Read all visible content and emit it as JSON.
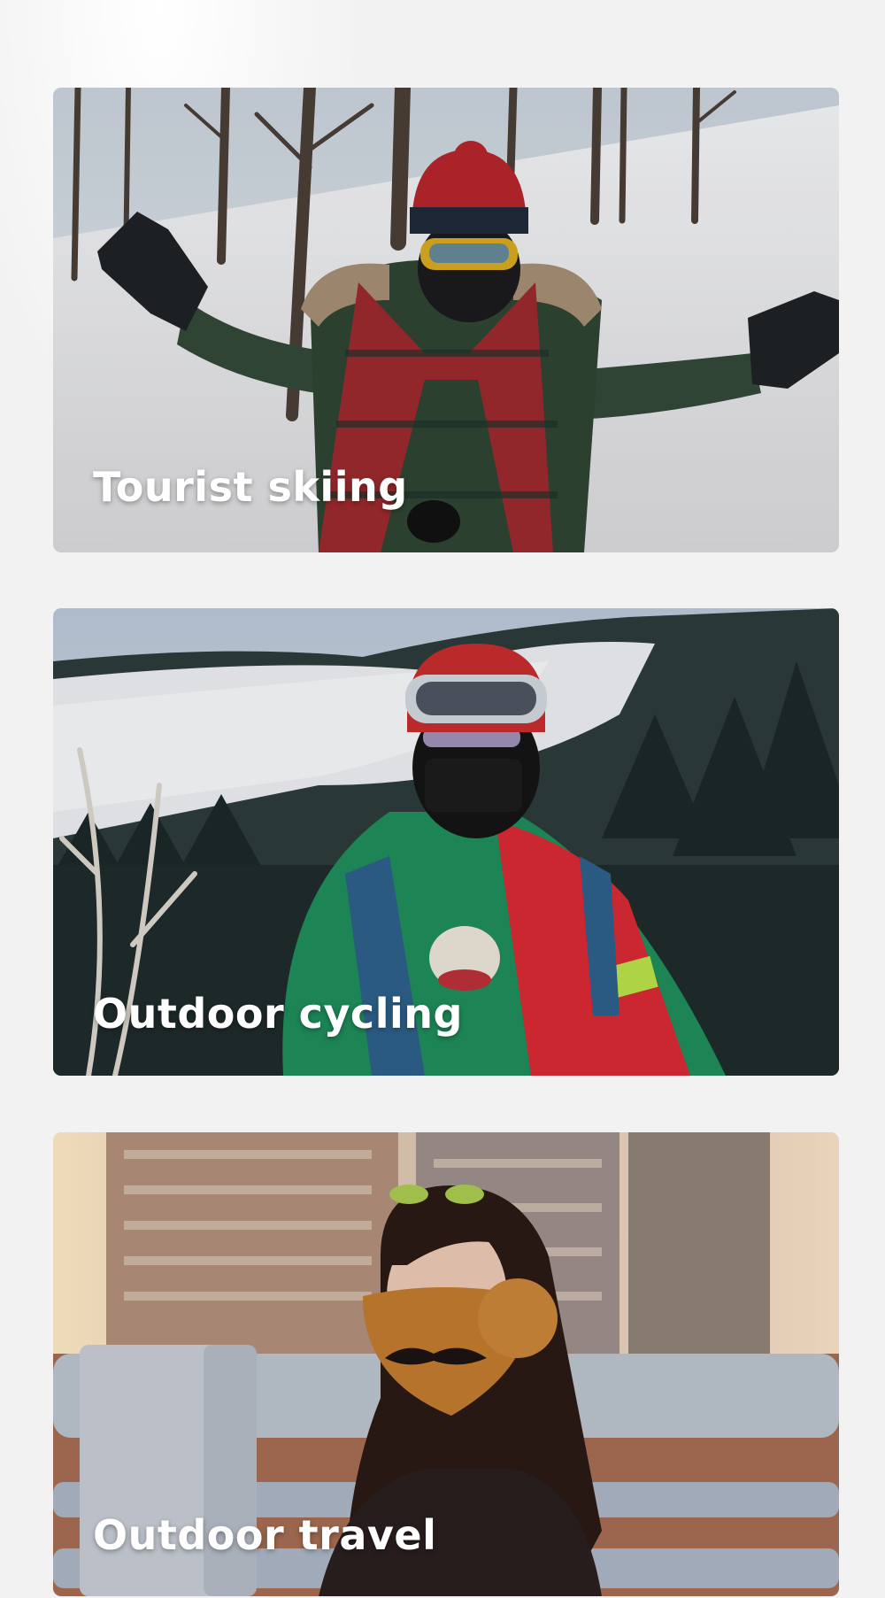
{
  "cards": [
    {
      "label": "Tourist skiing",
      "image": "person-skiing-in-snow-photo"
    },
    {
      "label": "Outdoor cycling",
      "image": "skier-with-helmet-in-forest-photo"
    },
    {
      "label": "Outdoor travel",
      "image": "woman-with-bear-mask-in-city-photo"
    }
  ],
  "colors": {
    "page_background": "#f2f2f2",
    "label_text": "#ffffff"
  }
}
